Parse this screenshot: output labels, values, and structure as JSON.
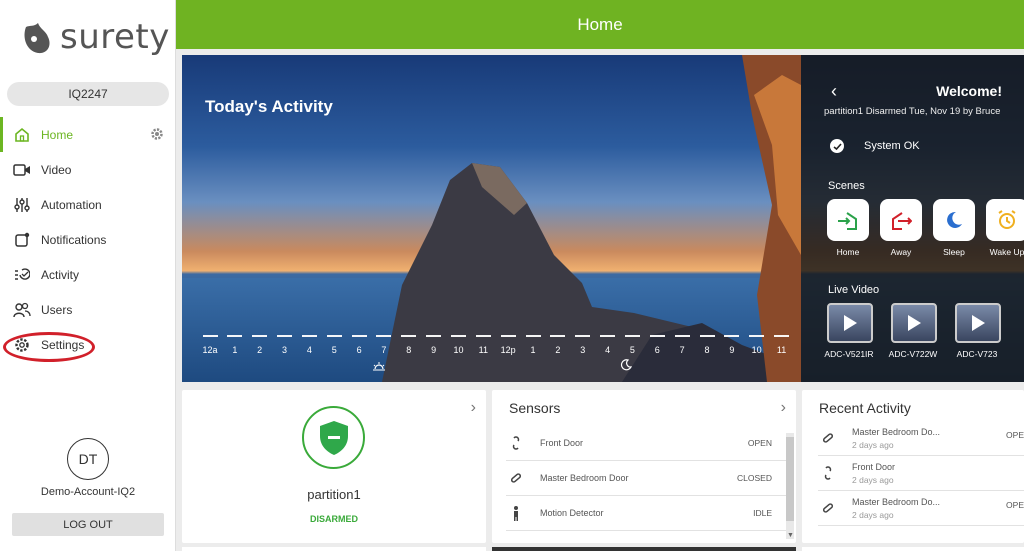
{
  "brand": {
    "logo_text": "surety"
  },
  "sidebar": {
    "account_id": "IQ2247",
    "items": [
      {
        "label": "Home",
        "icon": "home-icon"
      },
      {
        "label": "Video",
        "icon": "video-icon"
      },
      {
        "label": "Automation",
        "icon": "sliders-icon"
      },
      {
        "label": "Notifications",
        "icon": "notification-icon"
      },
      {
        "label": "Activity",
        "icon": "activity-icon"
      },
      {
        "label": "Users",
        "icon": "users-icon"
      },
      {
        "label": "Settings",
        "icon": "gear-icon"
      }
    ],
    "avatar_initials": "DT",
    "account_name": "Demo-Account-IQ2",
    "logout_label": "LOG OUT"
  },
  "header": {
    "title": "Home"
  },
  "hero": {
    "title": "Today's Activity",
    "timeline_labels": [
      "12a",
      "1",
      "2",
      "3",
      "4",
      "5",
      "6",
      "7",
      "8",
      "9",
      "10",
      "11",
      "12p",
      "1",
      "2",
      "3",
      "4",
      "5",
      "6",
      "7",
      "8",
      "9",
      "10",
      "11"
    ]
  },
  "welcome": {
    "title": "Welcome!",
    "subtitle": "partition1 Disarmed Tue, Nov 19 by Bruce",
    "system_status": "System OK",
    "scenes_label": "Scenes",
    "scenes": [
      {
        "name": "Home",
        "color": "#2aa24a"
      },
      {
        "name": "Away",
        "color": "#d1202a"
      },
      {
        "name": "Sleep",
        "color": "#2a6ecf"
      },
      {
        "name": "Wake Up",
        "color": "#f0b020"
      }
    ],
    "live_label": "Live Video",
    "videos": [
      {
        "name": "ADC-V521IR"
      },
      {
        "name": "ADC-V722W"
      },
      {
        "name": "ADC-V723"
      }
    ]
  },
  "partition": {
    "name": "partition1",
    "status": "DISARMED"
  },
  "sensors": {
    "title": "Sensors",
    "rows": [
      {
        "name": "Front Door",
        "state": "OPEN"
      },
      {
        "name": "Master Bedroom Door",
        "state": "CLOSED"
      },
      {
        "name": "Motion Detector",
        "state": "IDLE"
      }
    ]
  },
  "recent": {
    "title": "Recent Activity",
    "rows": [
      {
        "name": "Master Bedroom Do...",
        "when": "2 days ago",
        "state": "OPE"
      },
      {
        "name": "Front Door",
        "when": "2 days ago",
        "state": ""
      },
      {
        "name": "Master Bedroom Do...",
        "when": "2 days ago",
        "state": "OPE"
      }
    ]
  },
  "colors": {
    "accent": "#6fb322",
    "alert": "#d1202a"
  }
}
